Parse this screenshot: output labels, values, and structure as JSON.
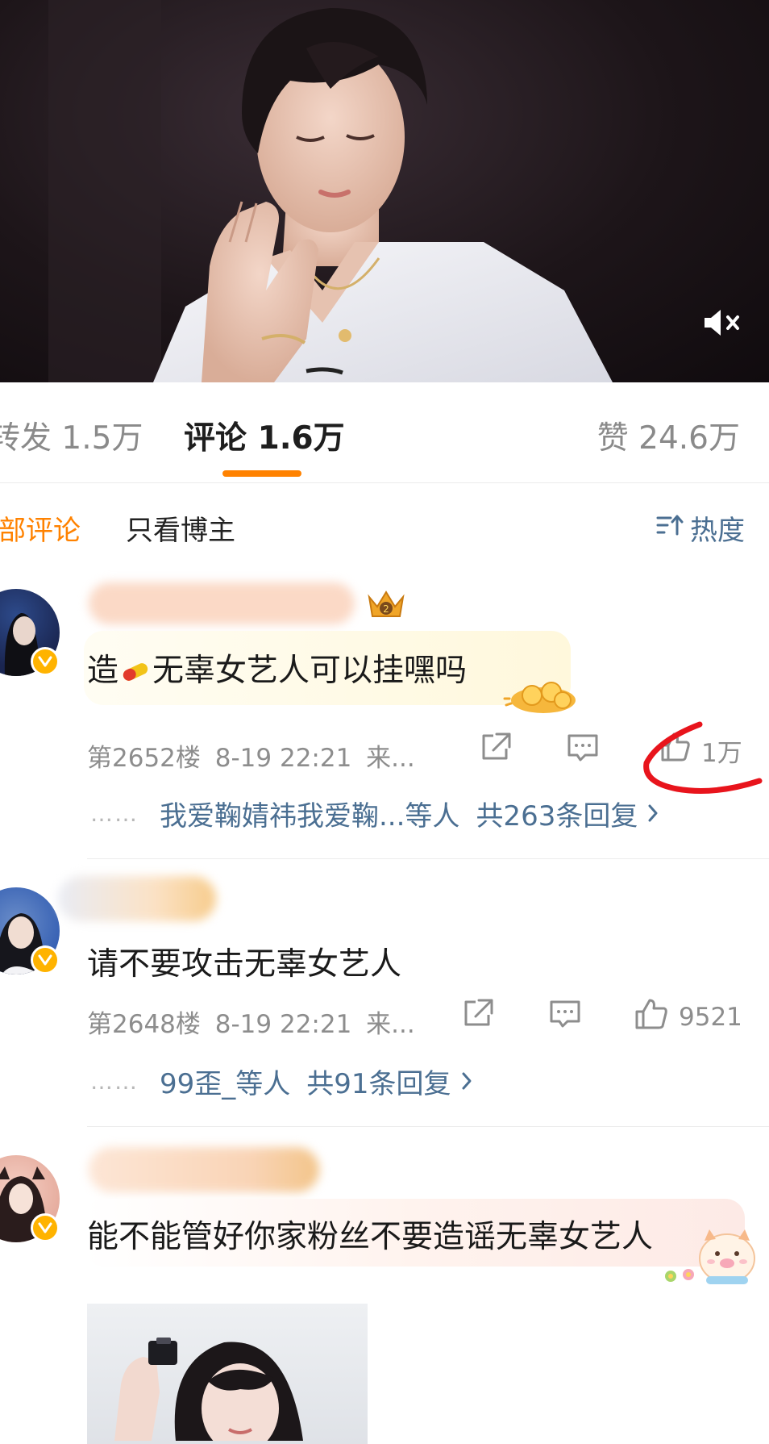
{
  "video": {
    "mute_icon": "speaker-muted-icon"
  },
  "tabs": {
    "repost": {
      "label": "转发",
      "count": "1.5万"
    },
    "comments": {
      "label": "评论",
      "count": "1.6万"
    },
    "likes": {
      "label": "赞",
      "count": "24.6万"
    }
  },
  "filters": {
    "all": "全部评论",
    "owner_only": "只看博主",
    "sort": "热度",
    "sort_icon": "sort-icon"
  },
  "comments": [
    {
      "text_before_emoji": "造",
      "emoji": "pill-emoji",
      "text_after_emoji": "无辜女艺人可以挂嘿吗",
      "floor": "第2652楼",
      "time": "8-19 22:21",
      "source": "来...",
      "likes": "1万",
      "reply_users": "我爱鞠婧祎我爱鞠...等人",
      "reply_count": "共263条回复",
      "badge_icon": "fan-crown-badge-icon",
      "annotation_color": "#e8141c"
    },
    {
      "text": "请不要攻击无辜女艺人",
      "floor": "第2648楼",
      "time": "8-19 22:21",
      "source": "来...",
      "likes": "9521",
      "reply_users": "99歪_等人",
      "reply_count": "共91条回复"
    },
    {
      "text": "能不能管好你家粉丝不要造谣无辜女艺人",
      "decoration": "pig-sticker-icon"
    }
  ],
  "colors": {
    "accent": "#ff8200",
    "link": "#4b6f92",
    "meta": "#8d8d8d",
    "badge": "#ffb300"
  }
}
